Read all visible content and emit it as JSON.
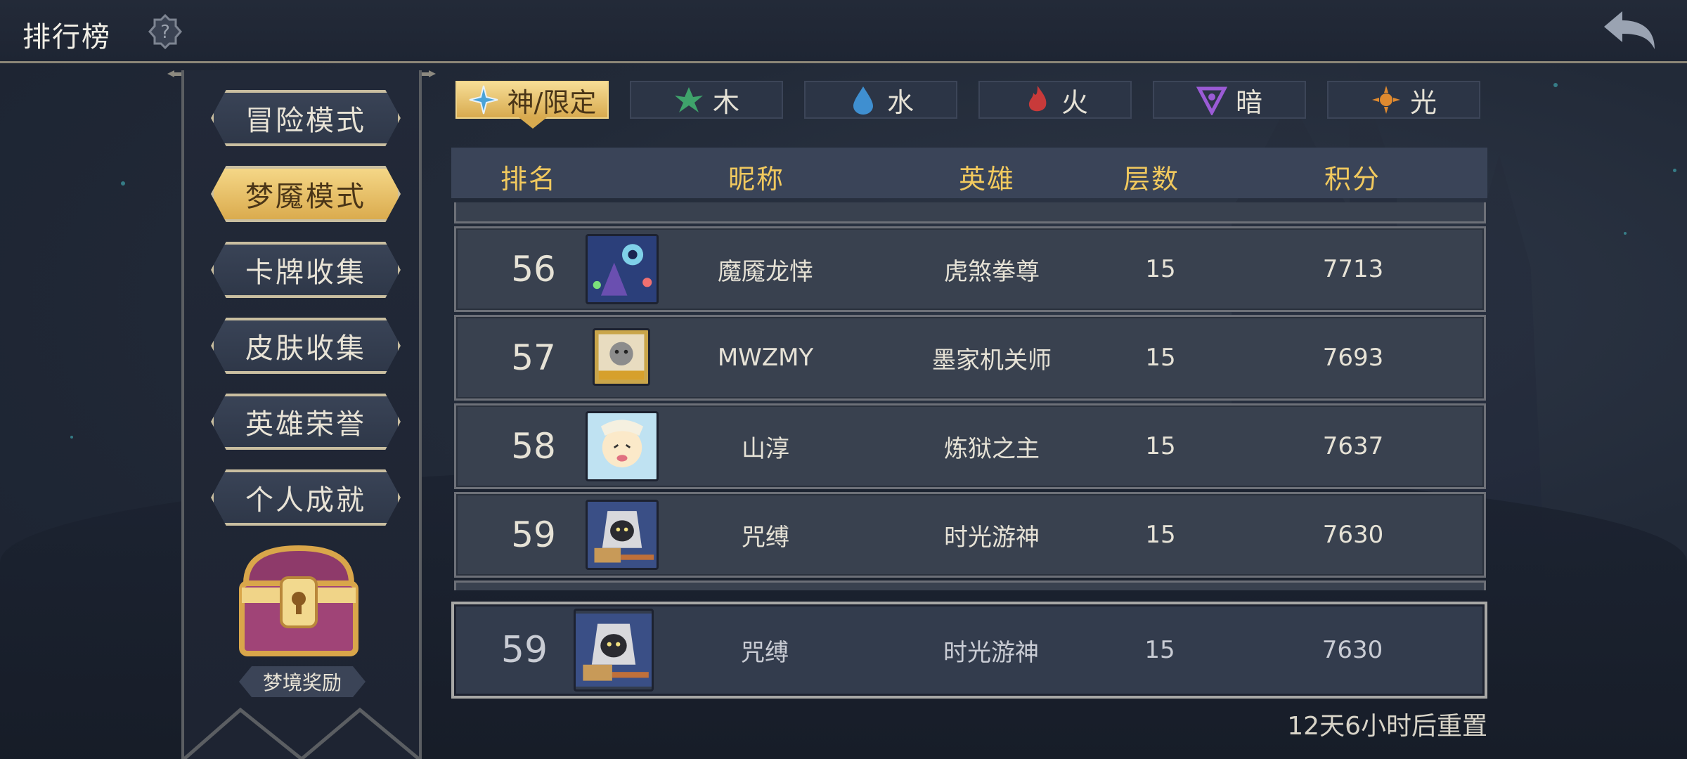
{
  "header": {
    "title": "排行榜",
    "help_icon": "question-badge-icon",
    "back_icon": "return-arrow-icon"
  },
  "sidebar": {
    "items": [
      {
        "label": "冒险模式",
        "active": false
      },
      {
        "label": "梦魇模式",
        "active": true
      },
      {
        "label": "卡牌收集",
        "active": false
      },
      {
        "label": "皮肤收集",
        "active": false
      },
      {
        "label": "英雄荣誉",
        "active": false
      },
      {
        "label": "个人成就",
        "active": false
      }
    ],
    "reward_label": "梦境奖励"
  },
  "tabs": [
    {
      "label": "神/限定",
      "icon": "divine-star-icon",
      "active": true,
      "color": "#4aa3d8"
    },
    {
      "label": "木",
      "icon": "leaf-icon",
      "active": false,
      "color": "#3fa36b"
    },
    {
      "label": "水",
      "icon": "water-drop-icon",
      "active": false,
      "color": "#3f8fd0"
    },
    {
      "label": "火",
      "icon": "fire-icon",
      "active": false,
      "color": "#c83a3a"
    },
    {
      "label": "暗",
      "icon": "dark-triangle-icon",
      "active": false,
      "color": "#9b5bd6"
    },
    {
      "label": "光",
      "icon": "sun-icon",
      "active": false,
      "color": "#e08a2f"
    }
  ],
  "table": {
    "columns": [
      "排名",
      "昵称",
      "英雄",
      "层数",
      "积分"
    ],
    "rows": [
      {
        "rank": "56",
        "nickname": "魔魇龙悻",
        "hero": "虎煞拳尊",
        "floors": "15",
        "score": "7713"
      },
      {
        "rank": "57",
        "nickname": "MWZMY",
        "hero": "墨家机关师",
        "floors": "15",
        "score": "7693"
      },
      {
        "rank": "58",
        "nickname": "山淳",
        "hero": "炼狱之主",
        "floors": "15",
        "score": "7637"
      },
      {
        "rank": "59",
        "nickname": "咒缚",
        "hero": "时光游神",
        "floors": "15",
        "score": "7630"
      }
    ]
  },
  "my_rank": {
    "rank": "59",
    "nickname": "咒缚",
    "hero": "时光游神",
    "floors": "15",
    "score": "7630"
  },
  "reset_text": "12天6小时后重置",
  "colors": {
    "accent_gold": "#f1c95e",
    "panel": "#39414f",
    "background": "#222a38"
  }
}
